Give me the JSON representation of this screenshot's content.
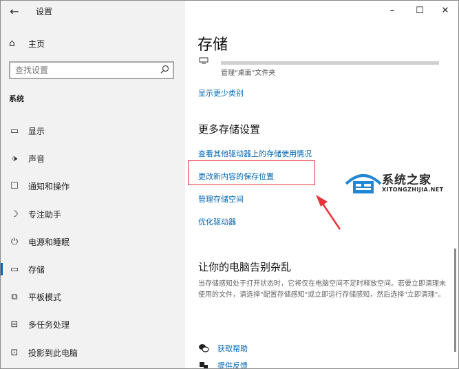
{
  "window": {
    "title": "设置"
  },
  "controls": {
    "minimize": "–",
    "maximize": "☐",
    "close": "✕"
  },
  "sidebar": {
    "home_label": "主页",
    "search_placeholder": "查找设置",
    "section_title": "系统",
    "items": [
      {
        "label": "显示",
        "icon": "display-icon"
      },
      {
        "label": "声音",
        "icon": "sound-icon"
      },
      {
        "label": "通知和操作",
        "icon": "notification-icon"
      },
      {
        "label": "专注助手",
        "icon": "focus-assist-icon"
      },
      {
        "label": "电源和睡眠",
        "icon": "power-icon"
      },
      {
        "label": "存储",
        "icon": "storage-icon",
        "active": true
      },
      {
        "label": "平板模式",
        "icon": "tablet-icon"
      },
      {
        "label": "多任务处理",
        "icon": "multitask-icon"
      },
      {
        "label": "投影到此电脑",
        "icon": "project-icon"
      }
    ]
  },
  "main": {
    "title": "存储",
    "bar_caption": "管理\"桌面\"文件夹",
    "show_fewer_link": "显示更少类别",
    "more_settings_heading": "更多存储设置",
    "links": [
      "查看其他驱动器上的存储使用情况",
      "更改新内容的保存位置",
      "管理存储空间",
      "优化驱动器"
    ],
    "declutter_heading": "让你的电脑告别杂乱",
    "declutter_desc": "当存储感知处于打开状态时，它将仅在电脑空间不足时释放空间。若要立即清理未使用的文件，请选择\"配置存储感知\"或立即运行存储感知，然后选择\"立即清理\"。",
    "help": {
      "get_help": "获取帮助",
      "feedback": "提供反馈"
    }
  },
  "watermark": {
    "name": "系统之家",
    "url": "XITONGZHIJIA.NET"
  },
  "colors": {
    "accent": "#0067c0",
    "link": "#0066b4",
    "highlight": "#e7333a"
  }
}
